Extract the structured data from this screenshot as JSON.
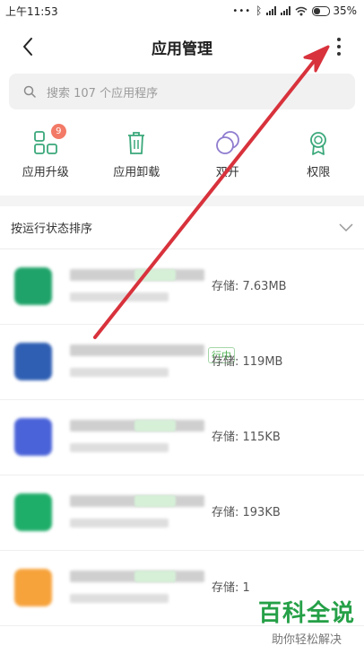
{
  "status_bar": {
    "time": "上午11:53",
    "dots": "•••",
    "battery": "35%",
    "battery_level": 0.35
  },
  "header": {
    "title": "应用管理",
    "back_icon": "chevron-left-icon",
    "more_icon": "more-vertical-icon"
  },
  "search": {
    "placeholder": "搜索 107 个应用程序"
  },
  "quick_actions": [
    {
      "label": "应用升级",
      "icon": "grid-upgrade-icon",
      "badge": "9"
    },
    {
      "label": "应用卸载",
      "icon": "trash-icon"
    },
    {
      "label": "双开",
      "icon": "dual-circle-icon"
    },
    {
      "label": "权限",
      "icon": "ribbon-badge-icon"
    }
  ],
  "sort": {
    "label": "按运行状态排序"
  },
  "apps": [
    {
      "size": "存储: 7.63MB",
      "icon_color": "#1fa36a"
    },
    {
      "size": "存储: 119MB",
      "icon_color": "#2f5fb3",
      "tag": "行中"
    },
    {
      "size": "存储: 115KB",
      "icon_color": "#4a63d8"
    },
    {
      "size": "存储: 193KB",
      "icon_color": "#1fae6a"
    },
    {
      "size": "存储: 1",
      "icon_color": "#f6a33c"
    }
  ],
  "watermark": {
    "title": "百科全说",
    "subtitle": "助你轻松解决"
  },
  "colors": {
    "accent_green": "#25a047",
    "arrow_red": "#d8323c",
    "badge": "#f27a66"
  }
}
